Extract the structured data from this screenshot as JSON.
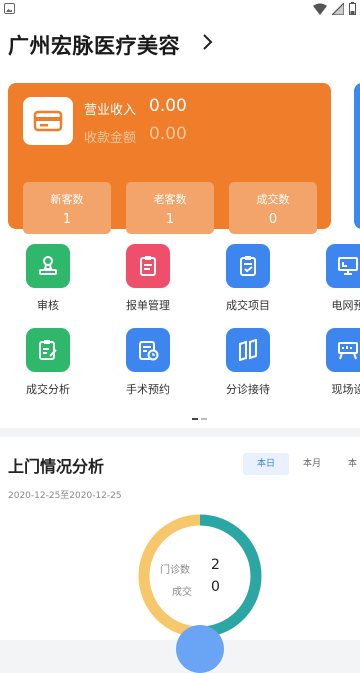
{
  "header": {
    "title": "广州宏脉医疗美容"
  },
  "revenue_card": {
    "income_label": "营业收入",
    "income_value": "0.00",
    "collection_label": "收款金额",
    "collection_value": "0.00",
    "stats": [
      {
        "label": "新客数",
        "value": "1"
      },
      {
        "label": "老客数",
        "value": "1"
      },
      {
        "label": "成交数",
        "value": "0"
      }
    ]
  },
  "menu": {
    "items": [
      {
        "label": "审核",
        "icon": "stamp-icon",
        "color": "#2fb86b"
      },
      {
        "label": "报单管理",
        "icon": "clipboard-icon",
        "color": "#ef4f6a"
      },
      {
        "label": "成交项目",
        "icon": "clipboard-check-icon",
        "color": "#3d86f0"
      },
      {
        "label": "电网预",
        "icon": "monitor-icon",
        "color": "#3d86f0"
      },
      {
        "label": "成交分析",
        "icon": "edit-doc-icon",
        "color": "#2fb86b"
      },
      {
        "label": "手术预约",
        "icon": "calendar-clock-icon",
        "color": "#3d86f0"
      },
      {
        "label": "分诊接待",
        "icon": "map-fold-icon",
        "color": "#3d86f0"
      },
      {
        "label": "现场设",
        "icon": "board-icon",
        "color": "#3d86f0"
      }
    ]
  },
  "analysis": {
    "title": "上门情况分析",
    "tabs": [
      "本日",
      "本月",
      "本"
    ],
    "active_tab": "本日",
    "date_range": "2020-12-25至2020-12-25",
    "legend": [
      {
        "label": "门诊数",
        "value": "2"
      },
      {
        "label": "成交",
        "value": "0"
      }
    ],
    "colors": {
      "first": "#2aa6a4",
      "second": "#f7c76b"
    }
  }
}
